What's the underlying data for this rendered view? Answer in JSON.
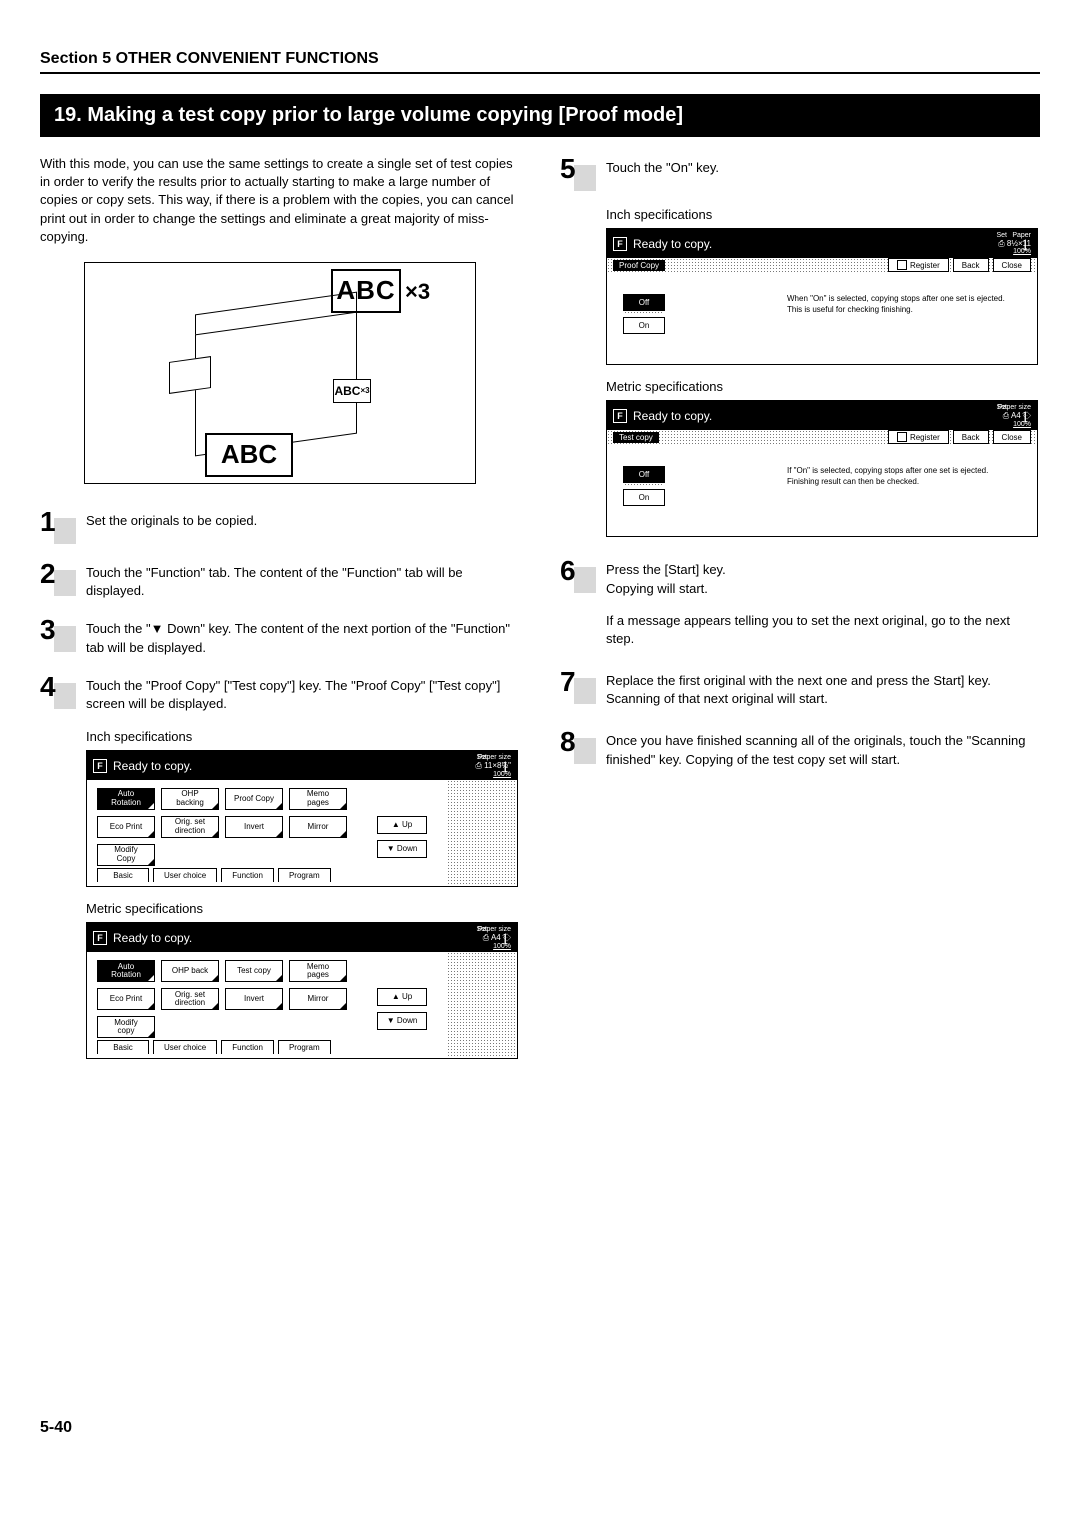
{
  "section_header": "Section 5  OTHER CONVENIENT FUNCTIONS",
  "title": "19. Making a test copy prior to large volume copying [Proof mode]",
  "intro": "With this mode, you can use the same settings to create a single set of test copies in order to verify the results prior to actually starting to make a large number of copies or copy sets. This way, if there is a problem with the copies, you can cancel print out in order to change the settings and eliminate a great majority of miss-copying.",
  "illus": {
    "big_abc": "ABC",
    "x3": "×3",
    "small_abc": "ABC",
    "small_x3": "×3",
    "bottom_abc": "ABC"
  },
  "steps": {
    "s1": "Set the originals to be copied.",
    "s2": "Touch the \"Function\" tab. The content of the \"Function\" tab will be displayed.",
    "s3": "Touch the \"▼ Down\" key. The content of the next portion of the \"Function\" tab will be displayed.",
    "s4": "Touch the \"Proof Copy\" [\"Test copy\"] key. The \"Proof Copy\" [\"Test copy\"] screen will be displayed.",
    "s5": "Touch the \"On\" key.",
    "s6a": "Press the [Start] key.",
    "s6b": "Copying will start.",
    "s6c": "If a message appears telling you to set the next original, go to the next step.",
    "s7": "Replace the first original with the next one and press the Start] key. Scanning of that next original will start.",
    "s8": "Once you have finished scanning all of the originals, touch the \"Scanning finished\" key. Copying of the test copy set will start."
  },
  "labels": {
    "inch_spec": "Inch specifications",
    "metric_spec": "Metric specifications"
  },
  "screen_common": {
    "ready": "Ready to copy.",
    "paper_size": "Paper size",
    "set": "Set",
    "pct": "100%",
    "count": "1",
    "icon": "F"
  },
  "screenA": {
    "size": "11×8½\"",
    "btns": {
      "auto_rotation": "Auto\nRotation",
      "ohp_backing": "OHP\nbacking",
      "proof_copy": "Proof Copy",
      "memo_pages": "Memo\npages",
      "eco_print": "Eco Print",
      "orig_set": "Orig. set\ndirection",
      "invert": "Invert",
      "mirror": "Mirror",
      "up": "▲  Up",
      "modify_copy": "Modify\nCopy",
      "down": "▼  Down"
    },
    "tabs": {
      "basic": "Basic",
      "user_choice": "User choice",
      "function": "Function",
      "program": "Program"
    }
  },
  "screenB": {
    "size": "A4",
    "size_icon": "⎙",
    "btns": {
      "auto_rotation": "Auto\nRotation",
      "ohp_back": "OHP back",
      "test_copy": "Test copy",
      "memo_pages": "Memo\npages",
      "eco_print": "Eco Print",
      "orig_set": "Orig. set\ndirection",
      "invert": "Invert",
      "mirror": "Mirror",
      "up": "▲  Up",
      "modify_copy": "Modify\ncopy",
      "down": "▼  Down"
    },
    "tabs": {
      "basic": "Basic",
      "user_choice": "User choice",
      "function": "Function",
      "program": "Program"
    }
  },
  "screenC": {
    "size": "8½×11",
    "label": "Proof Copy",
    "register": "Register",
    "back": "Back",
    "close": "Close",
    "off": "Off",
    "on": "On",
    "hint": "When \"On\" is selected, copying stops after one set is ejected.\nThis is useful for checking finishing."
  },
  "screenD": {
    "size": "A4",
    "size_icon": "⎙",
    "label": "Test copy",
    "register": "Register",
    "back": "Back",
    "close": "Close",
    "off": "Off",
    "on": "On",
    "hint": "If \"On\" is selected, copying stops after one set is ejected.\nFinishing result can then be checked."
  },
  "page_num": "5-40"
}
